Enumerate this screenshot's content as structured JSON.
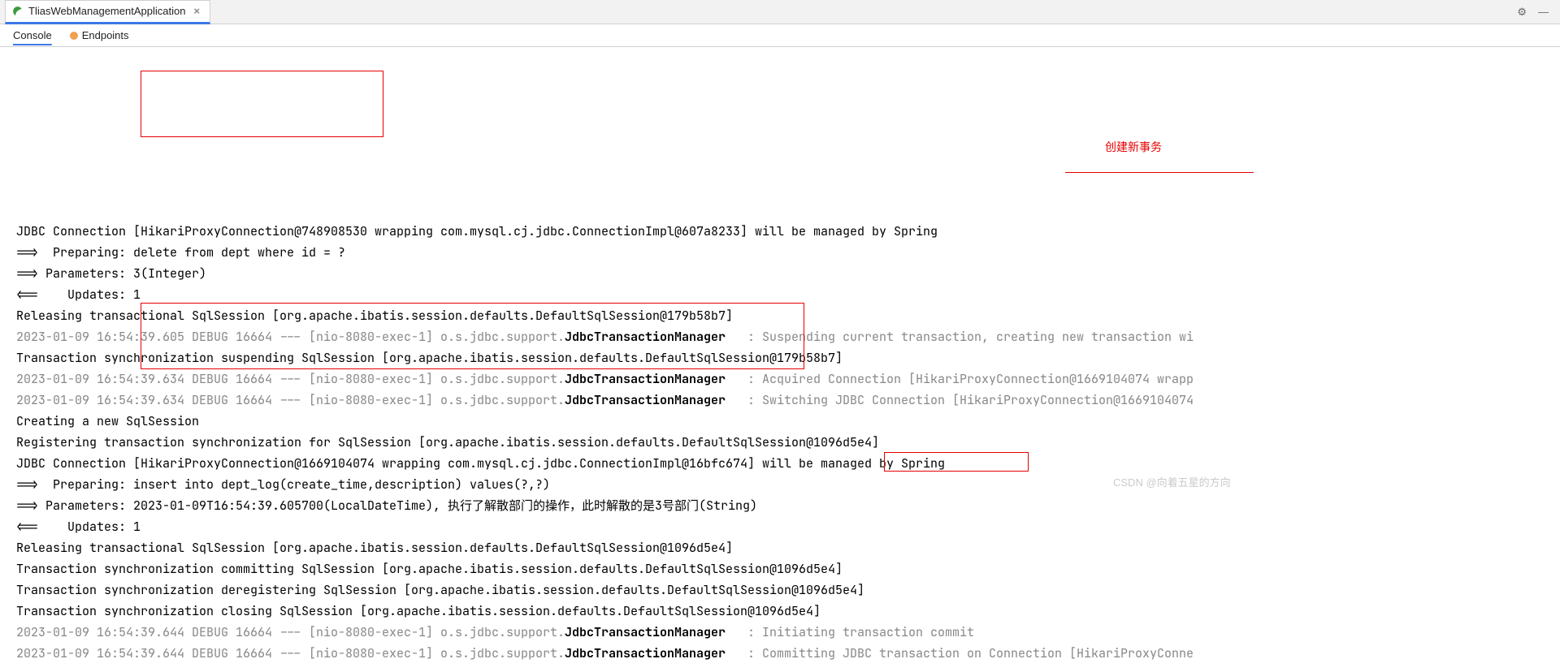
{
  "tab": {
    "title": "TliasWebManagementApplication"
  },
  "subtabs": {
    "console": "Console",
    "endpoints": "Endpoints"
  },
  "annotations": {
    "create_new_tx": "创建新事务"
  },
  "watermark": "CSDN @向着五星的方向",
  "lines": [
    {
      "cls": "log-line",
      "pre": "JDBC Connection [HikariProxyConnection@748908530 wrapping com.mysql.cj.jdbc.ConnectionImpl@607a8233] will be managed by Spring"
    },
    {
      "cls": "log-line",
      "pre": "==>  Preparing: delete from dept where id = ?"
    },
    {
      "cls": "log-line",
      "pre": "==> Parameters: 3(Integer)"
    },
    {
      "cls": "log-line",
      "pre": "<==    Updates: 1"
    },
    {
      "cls": "log-line",
      "pre": "Releasing transactional SqlSession [org.apache.ibatis.session.defaults.DefaultSqlSession@179b58b7]"
    },
    {
      "cls": "log-line gray",
      "pre": "2023-01-09 16:54:39.605 DEBUG 16664 --- [nio-8080-exec-1] o.s.jdbc.support.",
      "bold": "JdbcTransactionManager",
      "post": "   : Suspending current transaction, creating new transaction wi"
    },
    {
      "cls": "log-line",
      "pre": "Transaction synchronization suspending SqlSession [org.apache.ibatis.session.defaults.DefaultSqlSession@179b58b7]"
    },
    {
      "cls": "log-line gray",
      "pre": "2023-01-09 16:54:39.634 DEBUG 16664 --- [nio-8080-exec-1] o.s.jdbc.support.",
      "bold": "JdbcTransactionManager",
      "post": "   : Acquired Connection [HikariProxyConnection@1669104074 wrapp"
    },
    {
      "cls": "log-line gray",
      "pre": "2023-01-09 16:54:39.634 DEBUG 16664 --- [nio-8080-exec-1] o.s.jdbc.support.",
      "bold": "JdbcTransactionManager",
      "post": "   : Switching JDBC Connection [HikariProxyConnection@1669104074"
    },
    {
      "cls": "log-line",
      "pre": "Creating a new SqlSession"
    },
    {
      "cls": "log-line",
      "pre": "Registering transaction synchronization for SqlSession [org.apache.ibatis.session.defaults.DefaultSqlSession@1096d5e4]"
    },
    {
      "cls": "log-line",
      "pre": "JDBC Connection [HikariProxyConnection@1669104074 wrapping com.mysql.cj.jdbc.ConnectionImpl@16bfc674] will be managed by Spring"
    },
    {
      "cls": "log-line",
      "pre": "==>  Preparing: insert into dept_log(create_time,description) values(?,?)"
    },
    {
      "cls": "log-line",
      "pre": "==> Parameters: 2023-01-09T16:54:39.605700(LocalDateTime), 执行了解散部门的操作，此时解散的是3号部门(String)"
    },
    {
      "cls": "log-line",
      "pre": "<==    Updates: 1"
    },
    {
      "cls": "log-line",
      "pre": "Releasing transactional SqlSession [org.apache.ibatis.session.defaults.DefaultSqlSession@1096d5e4]"
    },
    {
      "cls": "log-line",
      "pre": "Transaction synchronization committing SqlSession [org.apache.ibatis.session.defaults.DefaultSqlSession@1096d5e4]"
    },
    {
      "cls": "log-line",
      "pre": "Transaction synchronization deregistering SqlSession [org.apache.ibatis.session.defaults.DefaultSqlSession@1096d5e4]"
    },
    {
      "cls": "log-line",
      "pre": "Transaction synchronization closing SqlSession [org.apache.ibatis.session.defaults.DefaultSqlSession@1096d5e4]"
    },
    {
      "cls": "log-line gray",
      "pre": "2023-01-09 16:54:39.644 DEBUG 16664 --- [nio-8080-exec-1] o.s.jdbc.support.",
      "bold": "JdbcTransactionManager",
      "post": "   : Initiating transaction commit"
    },
    {
      "cls": "log-line gray",
      "pre": "2023-01-09 16:54:39.644 DEBUG 16664 --- [nio-8080-exec-1] o.s.jdbc.support.",
      "bold": "JdbcTransactionManager",
      "post": "   : Committing JDBC transaction on Connection [HikariProxyConne"
    }
  ]
}
